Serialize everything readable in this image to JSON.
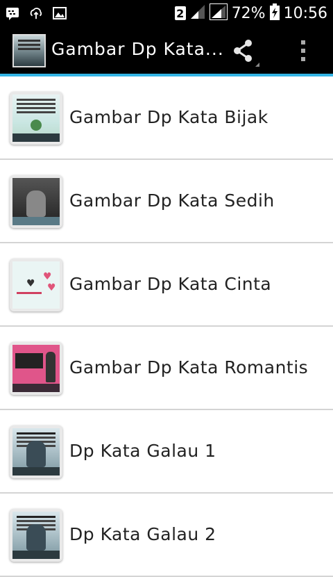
{
  "status_bar": {
    "sim_badge": "2",
    "battery_percent": "72%",
    "clock": "10:56",
    "icons": [
      "bbm-icon",
      "cloud-upload-icon",
      "image-icon",
      "signal-icon",
      "signal-icon",
      "battery-charging-icon"
    ]
  },
  "action_bar": {
    "title": "Gambar Dp Kata...",
    "icons": [
      "app-icon",
      "share-icon",
      "overflow-menu-icon"
    ]
  },
  "colors": {
    "accent": "#33b5e5",
    "bar_background": "#000000",
    "list_background": "#ffffff",
    "divider": "#d4d4d4"
  },
  "list": {
    "items": [
      {
        "label": "Gambar Dp Kata Bijak",
        "thumb": "kata-bijak-thumbnail"
      },
      {
        "label": "Gambar Dp Kata Sedih",
        "thumb": "kata-sedih-thumbnail"
      },
      {
        "label": "Gambar Dp Kata Cinta",
        "thumb": "kata-cinta-thumbnail"
      },
      {
        "label": "Gambar Dp Kata Romantis",
        "thumb": "kata-romantis-thumbnail"
      },
      {
        "label": "Dp Kata Galau 1",
        "thumb": "kata-galau-thumbnail"
      },
      {
        "label": "Dp Kata Galau 2",
        "thumb": "kata-galau-thumbnail"
      }
    ]
  }
}
